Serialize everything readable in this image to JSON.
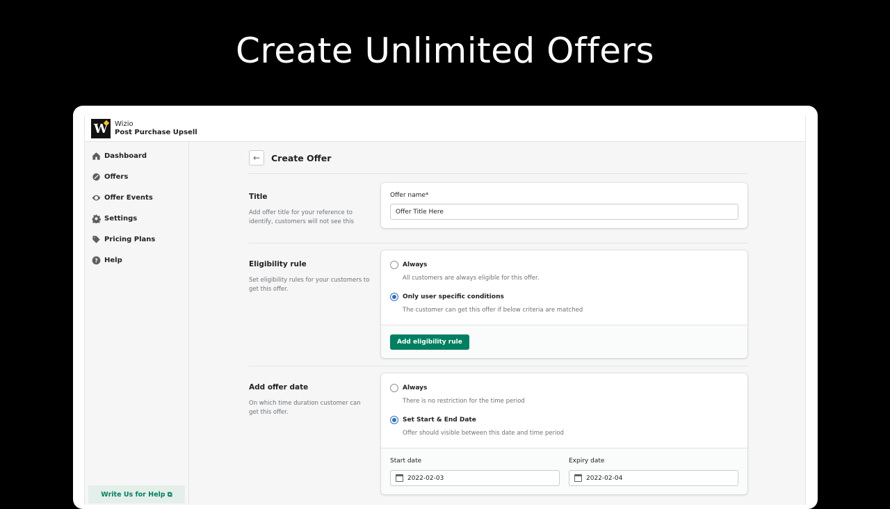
{
  "hero": {
    "title": "Create Unlimited Offers"
  },
  "app": {
    "brand_line1": "Wizio",
    "brand_line2": "Post Purchase Upsell",
    "logo_letter": "W"
  },
  "sidebar": {
    "items": [
      {
        "label": "Dashboard",
        "icon": "home-icon"
      },
      {
        "label": "Offers",
        "icon": "discount-icon"
      },
      {
        "label": "Offer Events",
        "icon": "eye-icon"
      },
      {
        "label": "Settings",
        "icon": "gear-icon"
      },
      {
        "label": "Pricing Plans",
        "icon": "tag-icon"
      },
      {
        "label": "Help",
        "icon": "question-icon"
      }
    ],
    "help_button": "Write Us for Help ⧉"
  },
  "page": {
    "title": "Create Offer",
    "back_icon": "arrow-left-icon"
  },
  "title_section": {
    "heading": "Title",
    "description": "Add offer title for your reference to identify, customers will not see this",
    "field_label": "Offer name*",
    "field_value": "Offer Title Here"
  },
  "eligibility": {
    "heading": "Eligibility rule",
    "description": "Set eligibility rules for your customers to get this offer.",
    "options": [
      {
        "label": "Always",
        "help": "All customers are always eligible for this offer.",
        "selected": false
      },
      {
        "label": "Only user specific conditions",
        "help": "The customer can get this offer if below criteria are matched",
        "selected": true
      }
    ],
    "button": "Add eligibility rule"
  },
  "offer_date": {
    "heading": "Add offer date",
    "description": "On which time duration customer can get this offer.",
    "options": [
      {
        "label": "Always",
        "help": "There is no restriction for the time period",
        "selected": false
      },
      {
        "label": "Set Start & End Date",
        "help": "Offer should visible between this date and time period",
        "selected": true
      }
    ],
    "start_label": "Start date",
    "start_value": "2022-02-03",
    "expiry_label": "Expiry date",
    "expiry_value": "2022-02-04"
  },
  "colors": {
    "primary_green": "#008060",
    "radio_blue": "#2c6ecb",
    "background": "#000000"
  }
}
